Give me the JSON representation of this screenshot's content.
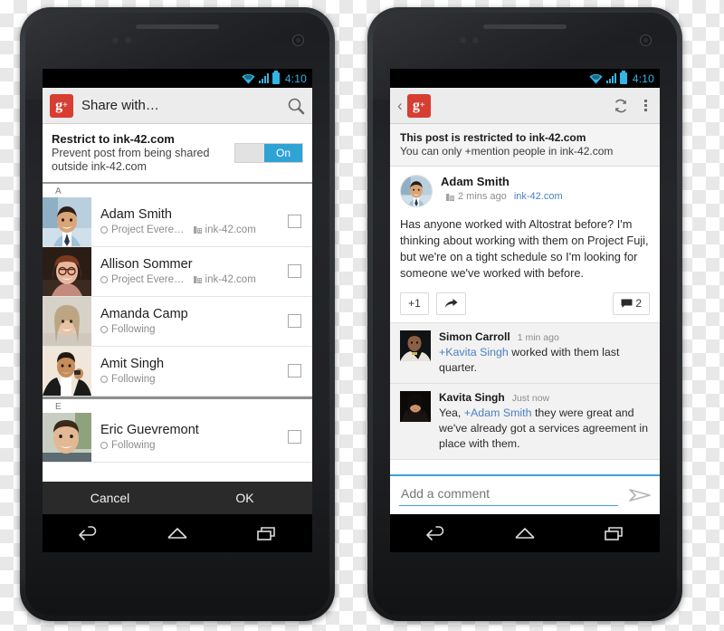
{
  "status_bar": {
    "time": "4:10",
    "wifi_icon": "wifi-icon",
    "signal_icon": "signal-bars-icon",
    "battery_icon": "battery-icon",
    "accent_color": "#33b5e5"
  },
  "colors": {
    "brand_red": "#d73d32",
    "accent_blue": "#2fa3d4",
    "link_blue": "#4b7fc4",
    "toggle_on": "#2fa3d4"
  },
  "left_phone": {
    "action_bar": {
      "logo": "g",
      "logo_sup": "+",
      "title": "Share with…",
      "search_icon": "search-icon"
    },
    "restrict": {
      "title": "Restrict to ink-42.com",
      "subtitle": "Prevent post from being shared outside ink-42.com",
      "toggle_label": "On",
      "toggle_state": "on"
    },
    "sections": [
      {
        "letter": "A",
        "contacts": [
          {
            "name": "Adam Smith",
            "circle": "Project Evere…",
            "domain": "ink-42.com",
            "checked": false
          },
          {
            "name": "Allison Sommer",
            "circle": "Project Evere…",
            "domain": "ink-42.com",
            "checked": false
          },
          {
            "name": "Amanda Camp",
            "circle": "Following",
            "domain": "",
            "checked": false
          },
          {
            "name": "Amit Singh",
            "circle": "Following",
            "domain": "",
            "checked": false
          }
        ]
      },
      {
        "letter": "E",
        "contacts": [
          {
            "name": "Eric Guevremont",
            "circle": "Following",
            "domain": "",
            "checked": false
          }
        ]
      }
    ],
    "dialog": {
      "cancel_label": "Cancel",
      "ok_label": "OK"
    }
  },
  "right_phone": {
    "action_bar": {
      "back_icon": "back-chevron-icon",
      "logo": "g",
      "logo_sup": "+",
      "refresh_icon": "refresh-icon",
      "overflow_icon": "overflow-menu-icon"
    },
    "notice": {
      "title": "This post is restricted to ink-42.com",
      "subtitle": "You can only +mention people in ink-42.com"
    },
    "post": {
      "author": "Adam Smith",
      "domain_icon": "domain-building-icon",
      "time": "2 mins ago",
      "domain": "ink-42.com",
      "body": "Has anyone worked with Altostrat before? I'm thinking about working with them on Project Fuji, but we're on a tight schedule so I'm looking for someone we've worked with before.",
      "actions": {
        "plus_one_label": "+1",
        "share_icon": "share-arrow-icon",
        "comment_icon": "comment-icon",
        "comment_count": "2"
      }
    },
    "comments": [
      {
        "author": "Simon Carroll",
        "time": "1 min ago",
        "mention": "+Kavita Singh",
        "text_before": "",
        "text_after": " worked with them last quarter."
      },
      {
        "author": "Kavita Singh",
        "time": "Just now",
        "mention": "+Adam Smith",
        "text_before": "Yea, ",
        "text_after": " they were great and we've already got a services agreement in place with them."
      }
    ],
    "composer": {
      "placeholder": "Add a comment",
      "value": "",
      "send_icon": "send-arrow-icon"
    }
  },
  "nav_bar": {
    "back_icon": "nav-back-icon",
    "home_icon": "nav-home-icon",
    "recents_icon": "nav-recents-icon"
  }
}
